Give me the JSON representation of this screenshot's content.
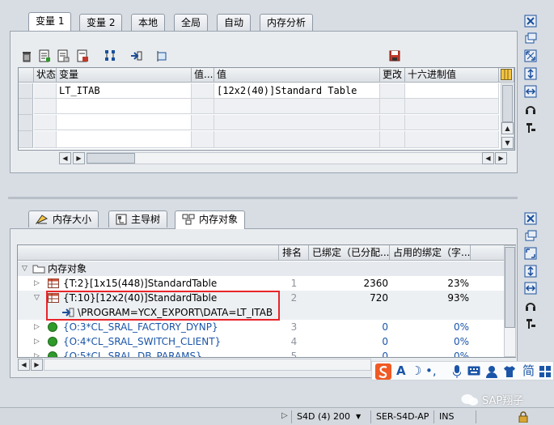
{
  "top_tabs": [
    "变量 1",
    "变量 2",
    "本地",
    "全局",
    "自动",
    "内存分析"
  ],
  "var_grid": {
    "headers": [
      "状态",
      "变量",
      "值...",
      "值",
      "更改",
      "十六进制值"
    ],
    "rows": [
      {
        "variable": "LT_ITAB",
        "value": "[12x2(40)]Standard Table"
      }
    ]
  },
  "bottom_tabs": [
    "内存大小",
    "主导树",
    "内存对象"
  ],
  "tree_grid": {
    "headers": [
      "",
      "排名",
      "已绑定（已分配...",
      "占用的绑定（字..."
    ],
    "root": "内存对象",
    "rows": [
      {
        "label": "{T:2}[1x15(448)]StandardTable",
        "rank": "1",
        "bound": "2360",
        "pct": "23%"
      },
      {
        "label": "{T:10}[12x2(40)]StandardTable",
        "rank": "2",
        "bound": "720",
        "pct": "93%"
      },
      {
        "label": "\\PROGRAM=YCX_EXPORT\\DATA=LT_ITAB",
        "rank": "",
        "bound": "",
        "pct": ""
      },
      {
        "label": "{O:3*CL_SRAL_FACTORY_DYNP}",
        "rank": "3",
        "bound": "0",
        "pct": "0%"
      },
      {
        "label": "{O:4*CL_SRAL_SWITCH_CLIENT}",
        "rank": "4",
        "bound": "0",
        "pct": "0%"
      },
      {
        "label": "{O:5*CL_SRAL_DB_PARAMS}",
        "rank": "5",
        "bound": "0",
        "pct": "0%"
      }
    ]
  },
  "status_bar": {
    "system": "S4D (4) 200",
    "server": "SER-S4D-AP",
    "mode": "INS"
  },
  "ime": {
    "items": [
      "A",
      "简"
    ]
  },
  "watermark": "SAP翔子",
  "colors": {
    "highlight_border": "#e8252a",
    "object_blue": "#1a55a8",
    "node_green": "#2e9a2a"
  }
}
